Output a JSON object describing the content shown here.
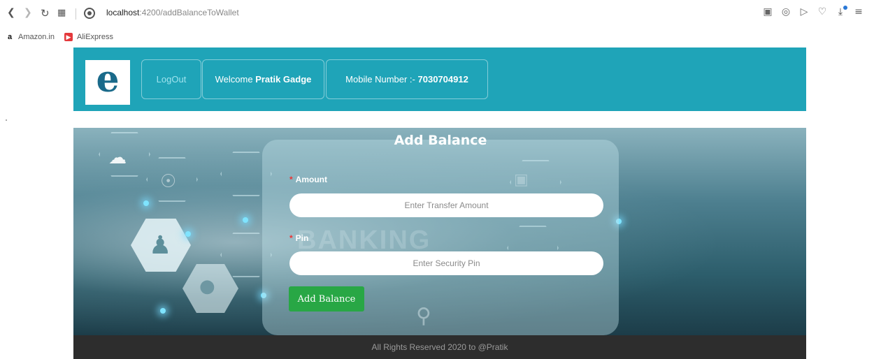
{
  "browser": {
    "url_host": "localhost",
    "url_path": ":4200/addBalanceToWallet",
    "bookmarks": [
      {
        "label": "Amazon.in",
        "icon": "amazon-icon"
      },
      {
        "label": "AliExpress",
        "icon": "aliexpress-icon"
      }
    ]
  },
  "header": {
    "logo_letter": "e",
    "logout_label": "LogOut",
    "welcome_prefix": "Welcome",
    "user_name": "Pratik Gadge",
    "mobile_prefix": "Mobile Number :-",
    "mobile_number": "7030704912",
    "bg_color": "#1fa4b8"
  },
  "banner": {
    "watermark": "BANKING"
  },
  "form": {
    "title": "Add Balance",
    "amount_label": "Amount",
    "amount_placeholder": "Enter Transfer Amount",
    "pin_label": "Pin",
    "pin_placeholder": "Enter Security Pin",
    "submit_label": "Add Balance",
    "submit_color": "#28a745"
  },
  "footer": {
    "text": "All Rights Reserved 2020 to @Pratik"
  }
}
